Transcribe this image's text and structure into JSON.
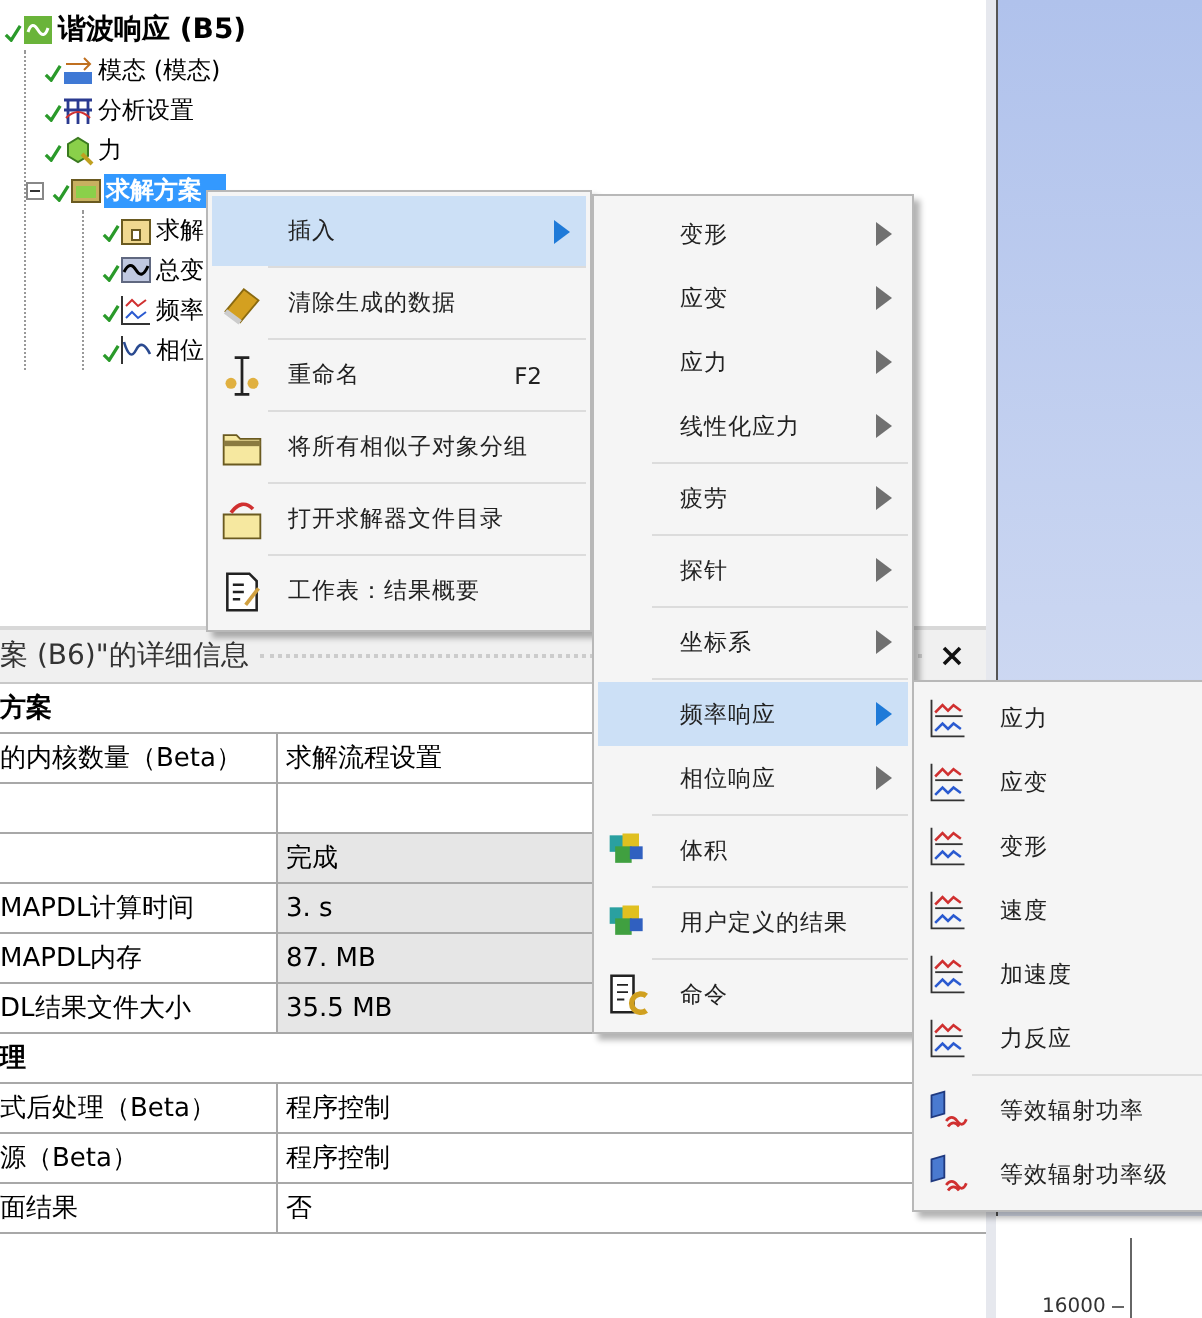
{
  "tree": {
    "items": [
      {
        "label": "谐波响应 (B5)",
        "kind": "harmonic",
        "solved": true,
        "selected": false,
        "children": [
          {
            "label": "模态 (模态)",
            "kind": "modal",
            "solved": true,
            "selected": false
          },
          {
            "label": "分析设置",
            "kind": "settings",
            "solved": true,
            "selected": false
          },
          {
            "label": "力",
            "kind": "force",
            "solved": true,
            "selected": false
          },
          {
            "label": "求解方案",
            "kind": "solution",
            "solved": true,
            "selected": true,
            "expanded": true,
            "children": [
              {
                "label": "求解",
                "kind": "info",
                "solved": true,
                "selected": false
              },
              {
                "label": "总变",
                "kind": "deformation",
                "solved": true,
                "selected": false
              },
              {
                "label": "频率",
                "kind": "frequency",
                "solved": true,
                "selected": false
              },
              {
                "label": "相位",
                "kind": "phase",
                "solved": true,
                "selected": false
              }
            ]
          }
        ]
      }
    ]
  },
  "details": {
    "title": "案 (B6)\"的详细信息",
    "rows": [
      {
        "kind": "section",
        "label": "方案"
      },
      {
        "kind": "property",
        "label": "的内核数量（Beta）",
        "value": "求解流程设置",
        "readonly": false
      },
      {
        "kind": "property",
        "readonly": false
      },
      {
        "kind": "property",
        "value": "完成",
        "readonly": true
      },
      {
        "kind": "property",
        "label": "MAPDL计算时间",
        "value": "3. s",
        "readonly": true
      },
      {
        "kind": "property",
        "label": "MAPDL内存",
        "value": "87. MB",
        "readonly": true
      },
      {
        "kind": "property",
        "label": "DL结果文件大小",
        "value": "35.5 MB",
        "readonly": true
      },
      {
        "kind": "section",
        "label": "理"
      },
      {
        "kind": "property",
        "label": "式后处理（Beta）",
        "value": "程序控制",
        "readonly": false
      },
      {
        "kind": "property",
        "label": "源（Beta）",
        "value": "程序控制",
        "readonly": false
      },
      {
        "kind": "property",
        "label": "面结果",
        "value": "否",
        "readonly": false
      }
    ]
  },
  "context_menu": {
    "items": [
      {
        "label": "插入",
        "kind": "none",
        "submenu": true,
        "selected": true,
        "divider": false
      },
      {
        "label": "清除生成的数据",
        "kind": "eraser",
        "submenu": false,
        "selected": false,
        "divider": true
      },
      {
        "label": "重命名",
        "shortcut": "F2",
        "kind": "rename",
        "submenu": false,
        "selected": false,
        "divider": true
      },
      {
        "label": "将所有相似子对象分组",
        "kind": "folder",
        "submenu": false,
        "selected": false,
        "divider": true
      },
      {
        "label": "打开求解器文件目录",
        "kind": "folderopen",
        "submenu": false,
        "selected": false,
        "divider": true
      },
      {
        "label": "工作表：结果概要",
        "kind": "worksheet",
        "submenu": false,
        "selected": false,
        "divider": true
      }
    ]
  },
  "insert_submenu": {
    "items": [
      {
        "label": "变形",
        "kind": "none",
        "submenu": true,
        "selected": false,
        "divider": false
      },
      {
        "label": "应变",
        "kind": "none",
        "submenu": true,
        "selected": false,
        "divider": false
      },
      {
        "label": "应力",
        "kind": "none",
        "submenu": true,
        "selected": false,
        "divider": false
      },
      {
        "label": "线性化应力",
        "kind": "none",
        "submenu": true,
        "selected": false,
        "divider": false
      },
      {
        "label": "疲劳",
        "kind": "none",
        "submenu": true,
        "selected": false,
        "divider": true
      },
      {
        "label": "探针",
        "kind": "none",
        "submenu": true,
        "selected": false,
        "divider": true
      },
      {
        "label": "坐标系",
        "kind": "none",
        "submenu": true,
        "selected": false,
        "divider": true
      },
      {
        "label": "频率响应",
        "kind": "none",
        "submenu": true,
        "selected": true,
        "divider": true
      },
      {
        "label": "相位响应",
        "kind": "none",
        "submenu": true,
        "selected": false,
        "divider": false
      },
      {
        "label": "体积",
        "kind": "cubes",
        "submenu": false,
        "selected": false,
        "divider": true
      },
      {
        "label": "用户定义的结果",
        "kind": "cubes",
        "submenu": false,
        "selected": false,
        "divider": true
      },
      {
        "label": "命令",
        "kind": "command",
        "submenu": false,
        "selected": false,
        "divider": true
      }
    ]
  },
  "frequency_submenu": {
    "items": [
      {
        "label": "应力",
        "kind": "response",
        "submenu": false,
        "selected": false,
        "divider": false
      },
      {
        "label": "应变",
        "kind": "response",
        "submenu": false,
        "selected": false,
        "divider": false
      },
      {
        "label": "变形",
        "kind": "response",
        "submenu": false,
        "selected": false,
        "divider": false
      },
      {
        "label": "速度",
        "kind": "response",
        "submenu": false,
        "selected": false,
        "divider": false
      },
      {
        "label": "加速度",
        "kind": "response",
        "submenu": false,
        "selected": false,
        "divider": false
      },
      {
        "label": "力反应",
        "kind": "response",
        "submenu": false,
        "selected": false,
        "divider": false
      },
      {
        "label": "等效辐射功率",
        "kind": "radiation",
        "submenu": false,
        "selected": false,
        "divider": true
      },
      {
        "label": "等效辐射功率级",
        "kind": "radiation",
        "submenu": false,
        "selected": false,
        "divider": false
      }
    ]
  },
  "chart_area": {
    "tick_label": "16000"
  }
}
